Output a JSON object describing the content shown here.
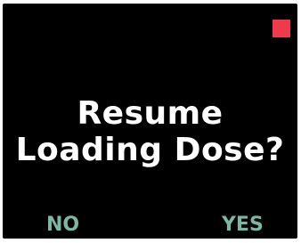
{
  "dialog": {
    "prompt_line1": "Resume",
    "prompt_line2": "Loading Dose?"
  },
  "softkeys": {
    "left_label": "NO",
    "right_label": "YES"
  },
  "status_indicator": {
    "color": "#ef3a4b"
  },
  "colors": {
    "screen_background": "#000000",
    "prompt_text": "#ffffff",
    "softkey_text": "#7ab8a3"
  }
}
